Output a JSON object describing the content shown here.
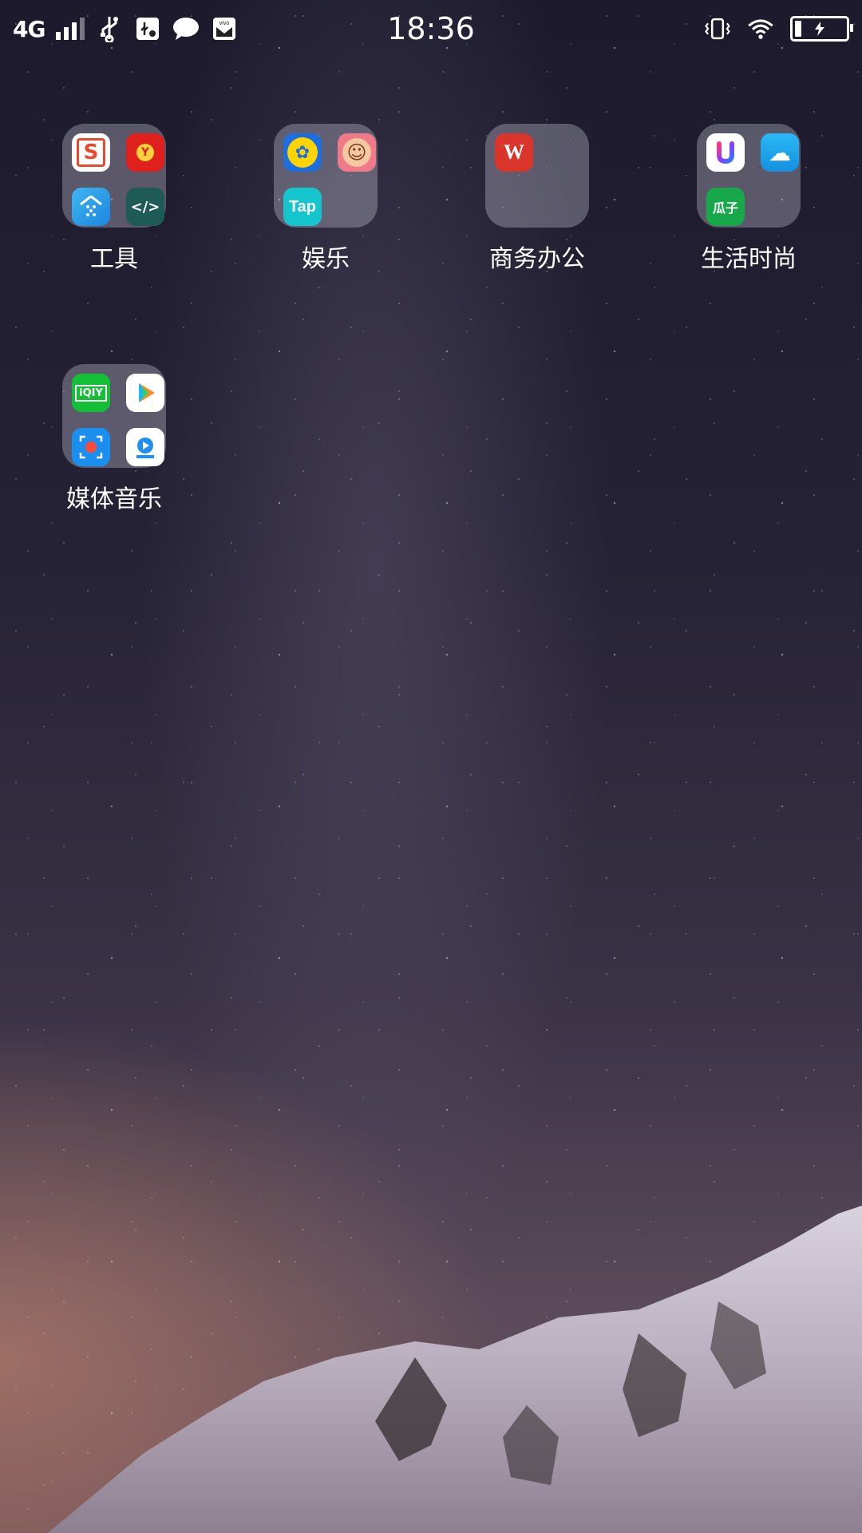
{
  "status_bar": {
    "network": "4G",
    "signal_bars": 3,
    "signal_max": 4,
    "icons": [
      "usb-icon",
      "usb-debug-icon",
      "message-icon",
      "vivo-mail-icon"
    ],
    "time": "18:36",
    "right_icons": [
      "vibrate-icon",
      "wifi-icon",
      "battery-charging-icon"
    ]
  },
  "folders": [
    {
      "label": "工具",
      "apps": [
        {
          "name": "sogou-input-icon",
          "glyph": "S",
          "color": "#e84a2b"
        },
        {
          "name": "yoga-app-icon",
          "glyph": "Y",
          "color": "#e0201c"
        },
        {
          "name": "smart-home-icon",
          "glyph": "⌂",
          "color": "#1e9de8"
        },
        {
          "name": "code-editor-icon",
          "glyph": "</>",
          "color": "#1f5b56"
        }
      ]
    },
    {
      "label": "娱乐",
      "apps": [
        {
          "name": "duck-app-icon",
          "glyph": "✿",
          "color": "#1b6fe0"
        },
        {
          "name": "monkey-game-icon",
          "glyph": "☺",
          "color": "#f07a8a"
        },
        {
          "name": "taptap-icon",
          "glyph": "Tap",
          "color": "#15c5ce"
        }
      ]
    },
    {
      "label": "商务办公",
      "apps": [
        {
          "name": "wps-office-icon",
          "glyph": "W",
          "color": "#d9352b"
        }
      ]
    },
    {
      "label": "生活时尚",
      "apps": [
        {
          "name": "u-app-icon",
          "glyph": "U",
          "color": "#ffffff"
        },
        {
          "name": "weather-icon",
          "glyph": "☁",
          "color": "#18a8ee"
        },
        {
          "name": "guazi-icon",
          "glyph": "瓜子",
          "color": "#17a84a"
        }
      ]
    },
    {
      "label": "媒体音乐",
      "apps": [
        {
          "name": "iqiyi-icon",
          "glyph": "iQIY",
          "color": "#13c035"
        },
        {
          "name": "video-player-icon",
          "glyph": "▶",
          "color": "#ffffff"
        },
        {
          "name": "screen-recorder-icon",
          "glyph": "●",
          "color": "#1b8ff0"
        },
        {
          "name": "live-video-icon",
          "glyph": "▶",
          "color": "#ffffff"
        }
      ]
    }
  ],
  "colors": {
    "sky_top": "#1c1a2c",
    "sky_bottom": "#6b5058",
    "folder_bg": "rgba(200,200,215,0.35)"
  }
}
